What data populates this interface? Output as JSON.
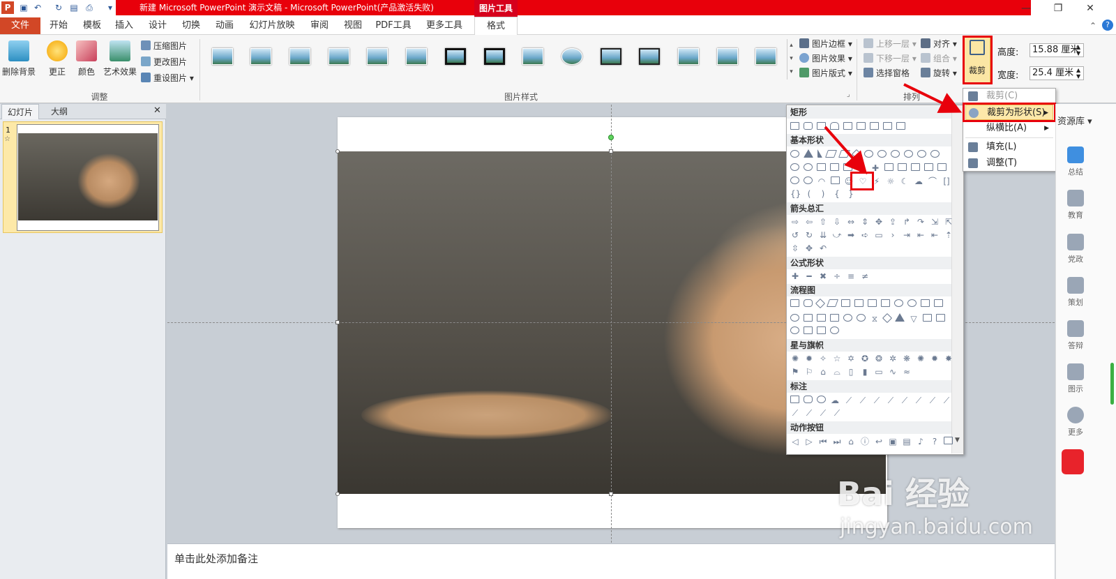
{
  "window": {
    "title": "新建 Microsoft PowerPoint 演示文稿 - Microsoft PowerPoint(产品激活失败)",
    "context_tab": "图片工具",
    "app_icon": "P",
    "controls": {
      "minimize": "—",
      "restore": "❐",
      "close": "✕"
    }
  },
  "ribbon_tabs": [
    "文件",
    "开始",
    "模板",
    "插入",
    "设计",
    "切换",
    "动画",
    "幻灯片放映",
    "审阅",
    "视图",
    "PDF工具",
    "更多工具",
    "格式"
  ],
  "adjust_group": {
    "label": "调整",
    "big_buttons": [
      "删除背景",
      "更正",
      "颜色",
      "艺术效果"
    ],
    "small_buttons": [
      "压缩图片",
      "更改图片",
      "重设图片"
    ]
  },
  "picture_styles_group": {
    "label": "图片样式",
    "count": 14
  },
  "picture_format_buttons": [
    "图片边框",
    "图片效果",
    "图片版式"
  ],
  "arrange_group": {
    "label": "排列",
    "buttons": [
      "上移一层",
      "下移一层",
      "选择窗格",
      "对齐",
      "组合",
      "旋转"
    ]
  },
  "size_group": {
    "crop_label": "裁剪",
    "height_label": "高度:",
    "height_value": "15.88 厘米",
    "width_label": "宽度:",
    "width_value": "25.4 厘米"
  },
  "left_panel": {
    "tabs": [
      "幻灯片",
      "大纲"
    ],
    "close": "✕",
    "slide_number": "1",
    "slide_star": "☆"
  },
  "notes_placeholder": "单击此处添加备注",
  "shape_gallery": {
    "categories": [
      "矩形",
      "基本形状",
      "箭头总汇",
      "公式形状",
      "流程图",
      "星与旗帜",
      "标注",
      "动作按钮"
    ]
  },
  "crop_menu": {
    "items": [
      "裁剪(C)",
      "裁剪为形状(S)",
      "纵横比(A)",
      "填充(L)",
      "调整(T)"
    ]
  },
  "right_sidebar": {
    "header": "资源库",
    "items": [
      "总结",
      "教育",
      "党政",
      "策划",
      "答辩",
      "图示",
      "更多"
    ]
  },
  "watermark": {
    "brand": "Bai  经验",
    "url": "jingyan.baidu.com"
  },
  "colors": {
    "accent_red": "#e8000b",
    "file_tab": "#d24726",
    "selected_slide": "#fde9a8"
  }
}
